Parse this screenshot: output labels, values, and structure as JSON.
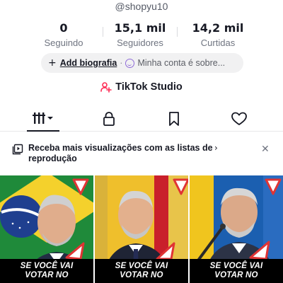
{
  "profile": {
    "username": "@shopyu10"
  },
  "stats": [
    {
      "value": "0",
      "label": "Seguindo"
    },
    {
      "value": "15,1 mil",
      "label": "Seguidores"
    },
    {
      "value": "14,2 mil",
      "label": "Curtidas"
    }
  ],
  "bio": {
    "add_label": "Add biografia",
    "about_label": "Minha conta é sobre..."
  },
  "studio": {
    "label": "TikTok Studio"
  },
  "tabs": [
    {
      "icon": "videos-grid-icon"
    },
    {
      "icon": "lock-icon"
    },
    {
      "icon": "bookmark-icon"
    },
    {
      "icon": "heart-icon"
    }
  ],
  "banner": {
    "text": "Receba mais visualizações com as listas de reprodução",
    "chevron": "›",
    "close": "✕"
  },
  "videos": [
    {
      "caption_line1": "SE VOCÊ VAI",
      "caption_line2": "VOTAR NO"
    },
    {
      "caption_line1": "SE VOCÊ VAI",
      "caption_line2": "VOTAR NO"
    },
    {
      "caption_line1": "SE VOCÊ VAI",
      "caption_line2": "VOTAR NO"
    }
  ],
  "colors": {
    "text_primary": "#161823",
    "text_secondary": "#6f7480",
    "pill_bg": "#f1f1f2",
    "studio_accent": "#fe2c55",
    "caption_bg": "#000000"
  }
}
